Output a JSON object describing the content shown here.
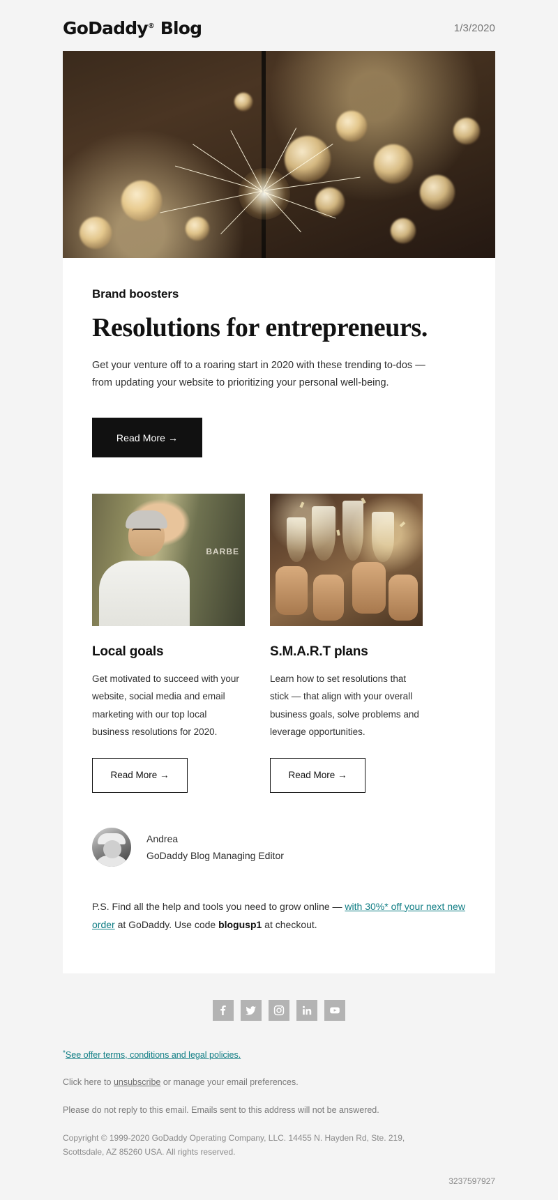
{
  "header": {
    "brand": "GoDaddy",
    "brand_tm": "®",
    "brand_suffix": "Blog",
    "date": "1/3/2020"
  },
  "hero": {
    "alt": "sparkler-bokeh-photo"
  },
  "article": {
    "eyebrow": "Brand boosters",
    "headline": "Resolutions for entrepreneurs.",
    "lede": "Get your venture off to a roaring start in 2020 with these trending to-dos — from updating your website to prioritizing your personal well-being.",
    "cta_label": "Read More →"
  },
  "columns": [
    {
      "image_alt": "barber-portrait-photo",
      "title": "Local goals",
      "text": "Get motivated to succeed with your website, social media and email marketing with our top local business resolutions for 2020.",
      "cta_label": "Read More →",
      "sign_text": "BARBE"
    },
    {
      "image_alt": "champagne-toast-photo",
      "title": "S.M.A.R.T plans",
      "text": "Learn how to set resolutions that stick — that align with your overall business goals, solve problems and leverage opportunities.",
      "cta_label": "Read More →"
    }
  ],
  "author": {
    "avatar_alt": "author-portrait",
    "name": "Andrea",
    "role": "GoDaddy Blog Managing Editor"
  },
  "ps": {
    "lead": "P.S. Find all the help and tools you need to grow online — ",
    "link": "with 30%* off your next new order",
    "middle": " at GoDaddy. Use code ",
    "code": "blogusp1",
    "tail": " at checkout."
  },
  "social": [
    {
      "name": "facebook",
      "label": "f"
    },
    {
      "name": "twitter",
      "label": "t"
    },
    {
      "name": "instagram",
      "label": "ig"
    },
    {
      "name": "linkedin",
      "label": "in"
    },
    {
      "name": "youtube",
      "label": "yt"
    }
  ],
  "footer": {
    "offer_star": "*",
    "offer_link": "See offer terms, conditions and legal policies.",
    "unsub_prefix": "Click here to ",
    "unsub_link": "unsubscribe",
    "unsub_suffix": " or manage your email preferences.",
    "no_reply": "Please do not reply to this email. Emails sent to this address will not be answered.",
    "copyright": "Copyright © 1999-2020 GoDaddy Operating Company, LLC. 14455 N. Hayden Rd, Ste. 219, Scottsdale, AZ 85260 USA. All rights reserved.",
    "message_id": "3237597927"
  },
  "colors": {
    "accent_link": "#0f7d84",
    "cta_bg": "#111111",
    "page_bg": "#f4f4f4",
    "card_bg": "#ffffff",
    "social_bg": "#b3b3b3"
  }
}
